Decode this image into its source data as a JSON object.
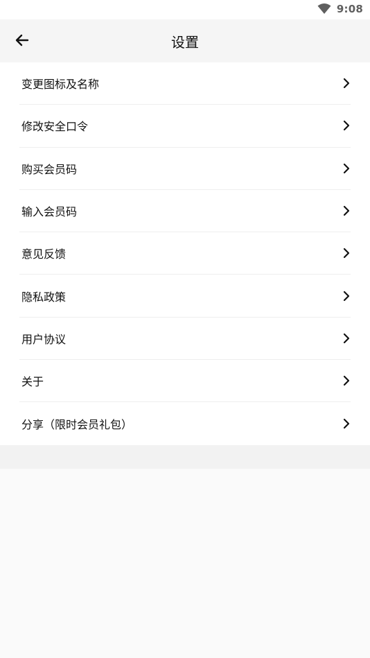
{
  "status": {
    "time": "9:08",
    "wifi_icon": "wifi-icon"
  },
  "header": {
    "back_icon": "arrow-left-icon",
    "title": "设置"
  },
  "menu": [
    {
      "label": "变更图标及名称",
      "name": "menu-item-change-icon-name"
    },
    {
      "label": "修改安全口令",
      "name": "menu-item-change-password"
    },
    {
      "label": "购买会员码",
      "name": "menu-item-buy-member-code"
    },
    {
      "label": "输入会员码",
      "name": "menu-item-enter-member-code"
    },
    {
      "label": "意见反馈",
      "name": "menu-item-feedback"
    },
    {
      "label": "隐私政策",
      "name": "menu-item-privacy-policy"
    },
    {
      "label": "用户协议",
      "name": "menu-item-user-agreement"
    },
    {
      "label": "关于",
      "name": "menu-item-about"
    },
    {
      "label": "分享（限时会员礼包）",
      "name": "menu-item-share"
    }
  ],
  "colors": {
    "page_bg": "#fafafa",
    "list_bg": "#ffffff",
    "divider": "#eeeeee",
    "text": "#111111"
  }
}
